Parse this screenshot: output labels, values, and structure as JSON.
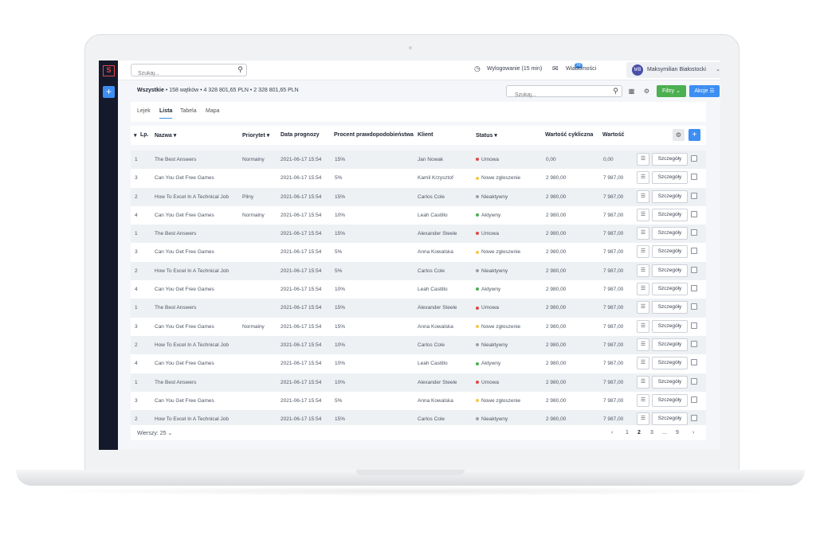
{
  "topbar": {
    "search_placeholder": "Szukaj...",
    "logout_label": "Wylogowanie (15 min)",
    "messages_label": "Wiadomości",
    "messages_badge": "10",
    "user_initials": "MB",
    "user_name": "Maksymilian Białostocki"
  },
  "filterbar": {
    "all_label": "Wszystkie",
    "summary_text": "• 158 wątków • 4 328 801,65 PLN • 2 328 801,65 PLN",
    "search_placeholder": "Szukaj...",
    "filters_label": "Filtry",
    "actions_label": "Akcje"
  },
  "tabs": [
    "Lejek",
    "Lista",
    "Tabela",
    "Mapa"
  ],
  "active_tab": "Lista",
  "columns": {
    "lp": "Lp.",
    "name": "Nazwa",
    "priority": "Priorytet",
    "date": "Data prognozy",
    "percent": "Procent prawdopodobieństwa",
    "client": "Klient",
    "status": "Status",
    "cyclic": "Wartość cykliczna",
    "value": "Wartość"
  },
  "details_label": "Szczegóły",
  "status_colors": {
    "Umowa": "#e04747",
    "Nowe zgłoszenie": "#f2c94c",
    "Nieaktywny": "#9aa0a8",
    "Aktywny": "#4caf50"
  },
  "rows": [
    {
      "lp": "1",
      "name": "The Best Answers",
      "priority": "Normalny",
      "date": "2021-06-17 15:54",
      "percent": "15%",
      "client": "Jan Nowak",
      "status": "Umowa",
      "cyclic": "0,00",
      "value": "0,00"
    },
    {
      "lp": "3",
      "name": "Can You Get Free Games",
      "priority": "",
      "date": "2021-06-17 15:54",
      "percent": "5%",
      "client": "Kamil Krzysztof",
      "status": "Nowe zgłoszenie",
      "cyclic": "2 980,00",
      "value": "7 987,00"
    },
    {
      "lp": "2",
      "name": "How To Excel In A Technical Job",
      "priority": "Pilny",
      "date": "2021-06-17 15:54",
      "percent": "15%",
      "client": "Carlos Cole",
      "status": "Nieaktywny",
      "cyclic": "2 980,00",
      "value": "7 987,00"
    },
    {
      "lp": "4",
      "name": "Can You Get Free Games",
      "priority": "Normalny",
      "date": "2021-06-17 15:54",
      "percent": "10%",
      "client": "Leah Castillo",
      "status": "Aktywny",
      "cyclic": "2 980,00",
      "value": "7 987,00"
    },
    {
      "lp": "1",
      "name": "The Best Answers",
      "priority": "",
      "date": "2021-06-17 15:54",
      "percent": "15%",
      "client": "Alexander Steele",
      "status": "Umowa",
      "cyclic": "2 980,00",
      "value": "7 987,00"
    },
    {
      "lp": "3",
      "name": "Can You Get Free Games",
      "priority": "",
      "date": "2021-06-17 15:54",
      "percent": "5%",
      "client": "Anna Kowalska",
      "status": "Nowe zgłoszenie",
      "cyclic": "2 980,00",
      "value": "7 987,00"
    },
    {
      "lp": "2",
      "name": "How To Excel In A Technical Job",
      "priority": "",
      "date": "2021-06-17 15:54",
      "percent": "5%",
      "client": "Carlos Cole",
      "status": "Nieaktywny",
      "cyclic": "2 980,00",
      "value": "7 987,00"
    },
    {
      "lp": "4",
      "name": "Can You Get Free Games",
      "priority": "",
      "date": "2021-06-17 15:54",
      "percent": "10%",
      "client": "Leah Castillo",
      "status": "Aktywny",
      "cyclic": "2 980,00",
      "value": "7 987,00"
    },
    {
      "lp": "1",
      "name": "The Best Answers",
      "priority": "",
      "date": "2021-06-17 15:54",
      "percent": "15%",
      "client": "Alexander Steele",
      "status": "Umowa",
      "cyclic": "2 980,00",
      "value": "7 987,00"
    },
    {
      "lp": "3",
      "name": "Can You Get Free Games",
      "priority": "Normalny",
      "date": "2021-06-17 15:54",
      "percent": "15%",
      "client": "Anna Kowalska",
      "status": "Nowe zgłoszenie",
      "cyclic": "2 980,00",
      "value": "7 987,00"
    },
    {
      "lp": "2",
      "name": "How To Excel In A Technical Job",
      "priority": "",
      "date": "2021-06-17 15:54",
      "percent": "10%",
      "client": "Carlos Cole",
      "status": "Nieaktywny",
      "cyclic": "2 980,00",
      "value": "7 987,00"
    },
    {
      "lp": "4",
      "name": "Can You Get Free Games",
      "priority": "",
      "date": "2021-06-17 15:54",
      "percent": "10%",
      "client": "Leah Castillo",
      "status": "Aktywny",
      "cyclic": "2 980,00",
      "value": "7 987,00"
    },
    {
      "lp": "1",
      "name": "The Best Answers",
      "priority": "",
      "date": "2021-06-17 15:54",
      "percent": "10%",
      "client": "Alexander Steele",
      "status": "Umowa",
      "cyclic": "2 980,00",
      "value": "7 987,00"
    },
    {
      "lp": "3",
      "name": "Can You Get Free Games",
      "priority": "",
      "date": "2021-06-17 15:54",
      "percent": "5%",
      "client": "Anna Kowalska",
      "status": "Nowe zgłoszenie",
      "cyclic": "2 980,00",
      "value": "7 987,00"
    },
    {
      "lp": "2",
      "name": "How To Excel In A Technical Job",
      "priority": "",
      "date": "2021-06-17 15:54",
      "percent": "15%",
      "client": "Carlos Cole",
      "status": "Nieaktywny",
      "cyclic": "2 980,00",
      "value": "7 987,00"
    }
  ],
  "footer": {
    "rows_per_page": "Wierszy: 25",
    "pages": [
      "1",
      "2",
      "3",
      "...",
      "9"
    ],
    "current_page": "2"
  }
}
